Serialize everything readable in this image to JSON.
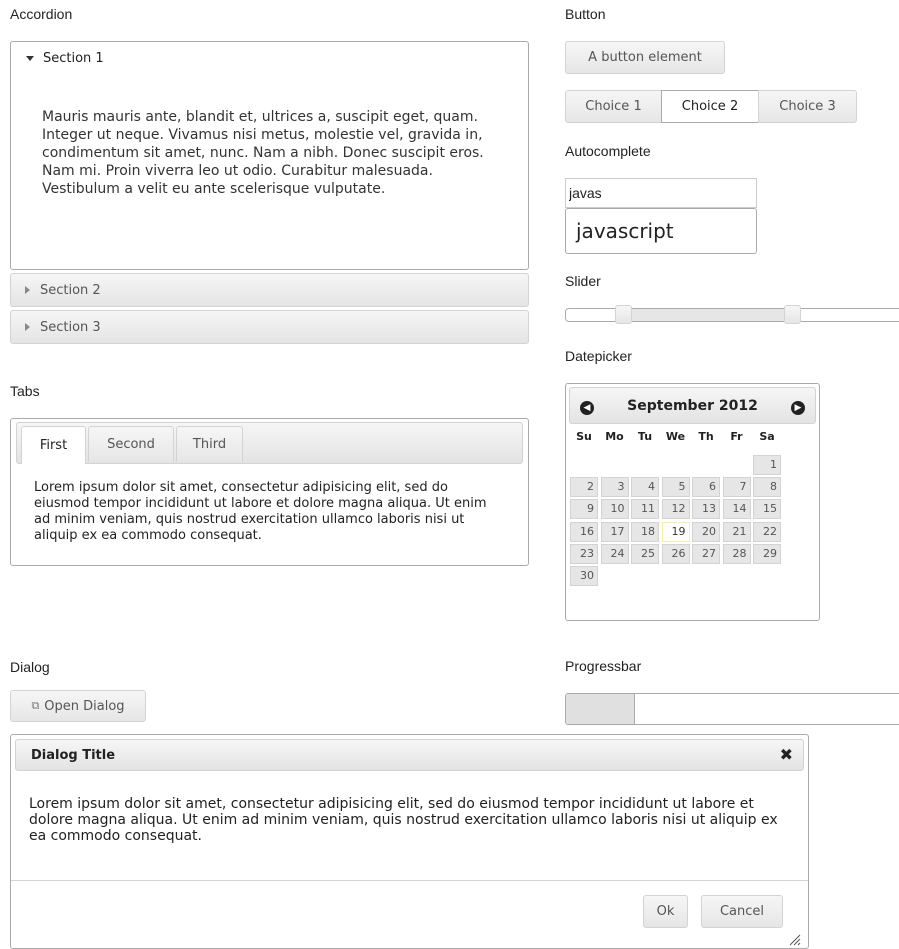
{
  "accordion": {
    "heading": "Accordion",
    "sections": [
      {
        "label": "Section 1",
        "content": "Mauris mauris ante, blandit et, ultrices a, suscipit eget, quam. Integer ut neque. Vivamus nisi metus, molestie vel, gravida in, condimentum sit amet, nunc. Nam a nibh. Donec suscipit eros. Nam mi. Proin viverra leo ut odio. Curabitur malesuada. Vestibulum a velit eu ante scelerisque vulputate."
      },
      {
        "label": "Section 2"
      },
      {
        "label": "Section 3"
      }
    ]
  },
  "button": {
    "heading": "Button",
    "element_label": "A button element",
    "choices": [
      "Choice 1",
      "Choice 2",
      "Choice 3"
    ],
    "selected_choice": "Choice 2"
  },
  "autocomplete": {
    "heading": "Autocomplete",
    "value": "javas",
    "suggestions": [
      "javascript"
    ]
  },
  "slider": {
    "heading": "Slider",
    "range_low": 0.17,
    "range_high": 0.67
  },
  "datepicker": {
    "heading": "Datepicker",
    "month_label": "September 2012",
    "weekdays": [
      "Su",
      "Mo",
      "Tu",
      "We",
      "Th",
      "Fr",
      "Sa"
    ],
    "first_weekday_index": 6,
    "days_in_month": 30,
    "today": 19,
    "prev_icon": "prev-circle-icon",
    "next_icon": "next-circle-icon"
  },
  "tabs": {
    "heading": "Tabs",
    "items": [
      "First",
      "Second",
      "Third"
    ],
    "active_tab": "First",
    "content": "Lorem ipsum dolor sit amet, consectetur adipisicing elit, sed do eiusmod tempor incididunt ut labore et dolore magna aliqua. Ut enim ad minim veniam, quis nostrud exercitation ullamco laboris nisi ut aliquip ex ea commodo consequat."
  },
  "dialog": {
    "heading": "Dialog",
    "open_label": "Open Dialog",
    "open_icon": "new-window-icon",
    "title": "Dialog Title",
    "close_icon": "close-icon",
    "body": "Lorem ipsum dolor sit amet, consectetur adipisicing elit, sed do eiusmod tempor incididunt ut labore et dolore magna aliqua. Ut enim ad minim veniam, quis nostrud exercitation ullamco laboris nisi ut aliquip ex ea commodo consequat.",
    "ok_label": "Ok",
    "cancel_label": "Cancel"
  },
  "progressbar": {
    "heading": "Progressbar",
    "value_fraction": 0.2
  },
  "colors": {
    "border": "#d3d3d3",
    "header_gradient_top": "#f6f6f6",
    "header_gradient_bottom": "#e3e3e3",
    "today_border": "#fcefa1"
  }
}
